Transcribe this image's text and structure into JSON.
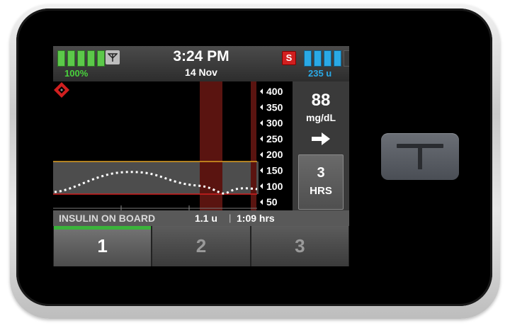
{
  "status": {
    "battery_percent": "100%",
    "time": "3:24 PM",
    "date": "14 Nov",
    "alert_badge": "S",
    "insulin_units": "235 u",
    "signal_icon": "antenna-icon"
  },
  "graph": {
    "y_ticks": [
      "400",
      "350",
      "300",
      "250",
      "200",
      "150",
      "100",
      "50"
    ],
    "high_threshold": 180,
    "low_threshold": 70,
    "colors": {
      "high": "#e0a020",
      "low": "#d11f1f",
      "event": "#5a1410",
      "trace": "#ffffff"
    }
  },
  "reading": {
    "value": "88",
    "unit": "mg/dL",
    "trend_icon": "arrow-right-icon",
    "timeframe_number": "3",
    "timeframe_label": "HRS"
  },
  "iob": {
    "label": "INSULIN ON BOARD",
    "units": "1.1 u",
    "separator": "|",
    "time": "1:09 hrs"
  },
  "tabs": [
    {
      "label": "1",
      "active": true
    },
    {
      "label": "2",
      "active": false
    },
    {
      "label": "3",
      "active": false
    }
  ],
  "colors": {
    "battery": "#5cc84a",
    "cartridge": "#2aa9e6",
    "active_tab": "#3bb33b"
  }
}
